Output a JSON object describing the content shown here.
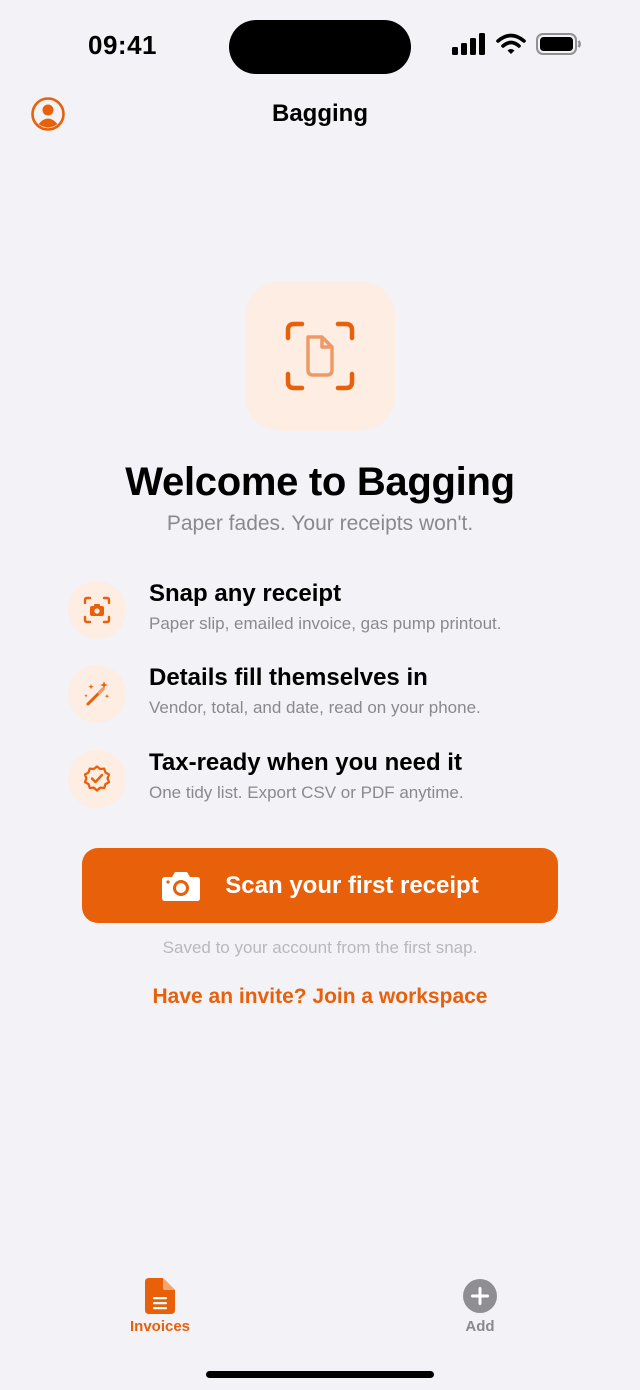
{
  "status_bar": {
    "time": "09:41"
  },
  "nav": {
    "title": "Bagging",
    "profile_icon": "person-circle-icon"
  },
  "hero": {
    "icon": "doc-viewfinder-icon",
    "title": "Welcome to Bagging",
    "subtitle": "Paper fades. Your receipts won't."
  },
  "features": [
    {
      "icon": "camera-viewfinder-icon",
      "title": "Snap any receipt",
      "desc": "Paper slip, emailed invoice, gas pump printout."
    },
    {
      "icon": "magic-wand-icon",
      "title": "Details fill themselves in",
      "desc": "Vendor, total, and date, read on your phone."
    },
    {
      "icon": "checkmark-seal-icon",
      "title": "Tax-ready when you need it",
      "desc": "One tidy list. Export CSV or PDF anytime."
    }
  ],
  "cta": {
    "label": "Scan your first receipt",
    "icon": "camera-icon"
  },
  "saved_note": "Saved to your account from the first snap.",
  "invite_link": "Have an invite? Join a workspace",
  "tabs": [
    {
      "label": "Invoices",
      "icon": "document-icon",
      "active": true
    },
    {
      "label": "Add",
      "icon": "plus-circle-icon",
      "active": false
    }
  ],
  "colors": {
    "accent": "#E8600A",
    "accent_soft": "#FDEDE3",
    "background": "#F2F2F7",
    "secondary_text": "#8A8A8E"
  }
}
